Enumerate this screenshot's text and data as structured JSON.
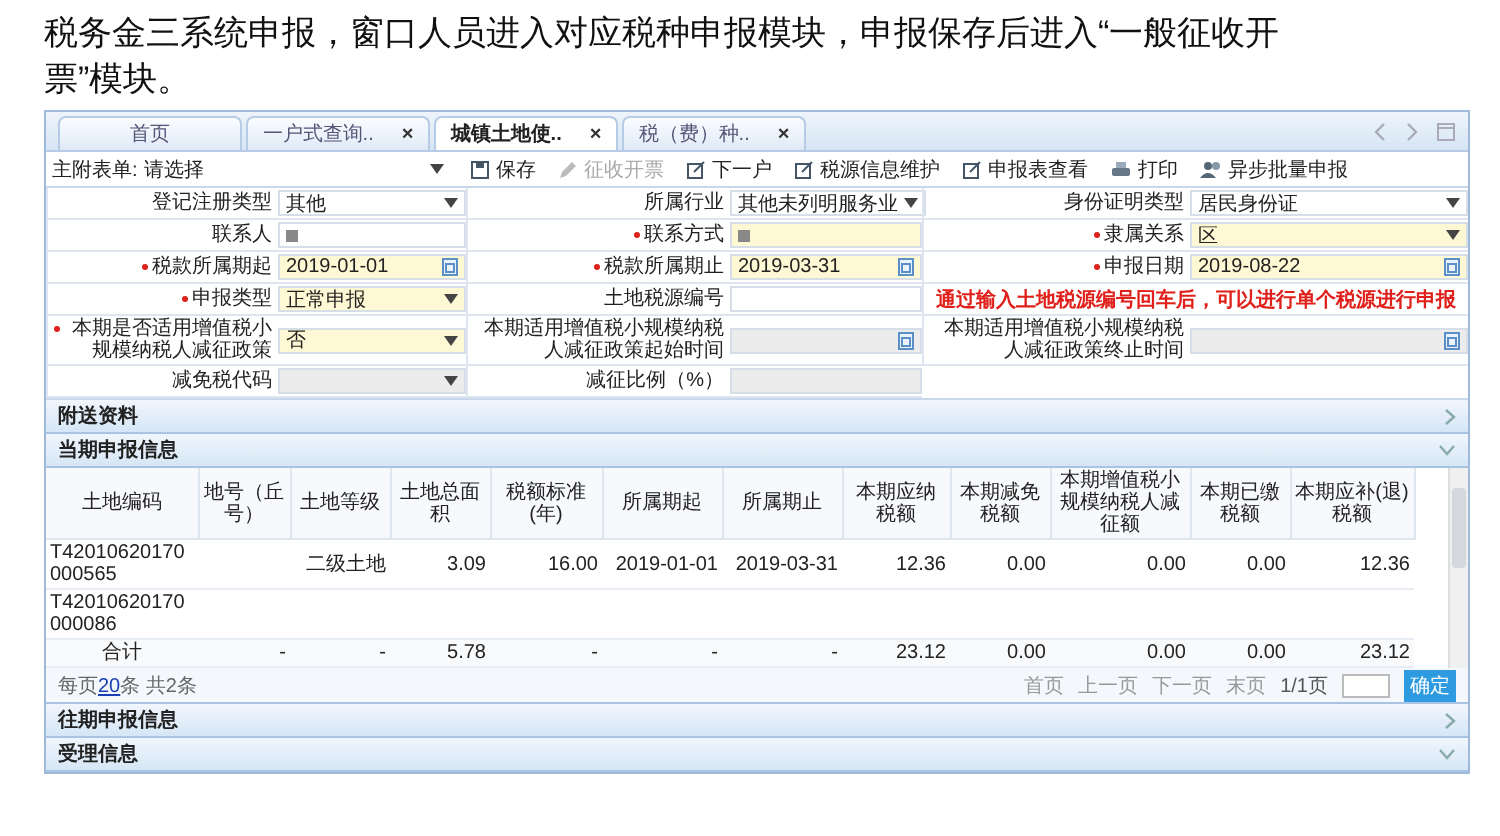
{
  "heading": "税务金三系统申报，窗口人员进入对应税种申报模块，申报保存后进入“一般征收开票”模块。",
  "tabs": [
    {
      "label": "首页",
      "selected": false
    },
    {
      "label": "一户式查询..",
      "close": "×",
      "selected": false
    },
    {
      "label": "城镇土地使..",
      "close": "×",
      "selected": true
    },
    {
      "label": "税（费）种..",
      "close": "×",
      "selected": false
    }
  ],
  "toolbar": {
    "form_select": {
      "label": "主附表单:",
      "value": "请选择"
    },
    "buttons": [
      {
        "label": "保存",
        "kind": "save",
        "disabled": false
      },
      {
        "label": "征收开票",
        "kind": "pencil",
        "disabled": true
      },
      {
        "label": "下一户",
        "kind": "edit",
        "disabled": false
      },
      {
        "label": "税源信息维护",
        "kind": "edit",
        "disabled": false
      },
      {
        "label": "申报表查看",
        "kind": "edit",
        "disabled": false
      },
      {
        "label": "打印",
        "kind": "print",
        "disabled": false
      },
      {
        "label": "异步批量申报",
        "kind": "people",
        "disabled": false
      }
    ]
  },
  "form": {
    "rows": [
      [
        {
          "label": "登记注册类型",
          "required": false,
          "disabled": false,
          "kind": "select",
          "value": "其他"
        },
        {
          "label": "所属行业",
          "required": false,
          "disabled": false,
          "kind": "select",
          "value": "其他未列明服务业"
        },
        {
          "label": "身份证明类型",
          "required": false,
          "disabled": false,
          "kind": "select",
          "value": "居民身份证"
        }
      ],
      [
        {
          "label": "联系人",
          "required": false,
          "disabled": false,
          "kind": "redacted"
        },
        {
          "label": "联系方式",
          "required": true,
          "disabled": false,
          "kind": "redacted"
        },
        {
          "label": "隶属关系",
          "required": true,
          "disabled": false,
          "kind": "select",
          "value": "区"
        }
      ],
      [
        {
          "label": "税款所属期起",
          "required": true,
          "disabled": false,
          "kind": "date",
          "value": "2019-01-01"
        },
        {
          "label": "税款所属期止",
          "required": true,
          "disabled": false,
          "kind": "date",
          "value": "2019-03-31"
        },
        {
          "label": "申报日期",
          "required": true,
          "disabled": false,
          "kind": "date",
          "value": "2019-08-22"
        }
      ],
      [
        {
          "label": "申报类型",
          "required": true,
          "disabled": false,
          "kind": "select",
          "value": "正常申报"
        },
        {
          "label": "土地税源编号",
          "required": false,
          "disabled": false,
          "kind": "text"
        },
        {
          "kind": "notice",
          "text": "通过输入土地税源编号回车后，可以进行单个税源进行申报"
        }
      ],
      [
        {
          "label": "本期是否适用增值税小规模纳税人减征政策",
          "required": true,
          "disabled": false,
          "kind": "select",
          "value": "否"
        },
        {
          "label": "本期适用增值税小规模纳税人减征政策起始时间",
          "required": false,
          "disabled": true,
          "kind": "date"
        },
        {
          "label": "本期适用增值税小规模纳税人减征政策终止时间",
          "required": false,
          "disabled": true,
          "kind": "date"
        }
      ],
      [
        {
          "label": "减免税代码",
          "required": false,
          "disabled": true,
          "kind": "select"
        },
        {
          "label": "减征比例（%）",
          "required": false,
          "disabled": true,
          "kind": "text"
        }
      ]
    ]
  },
  "sections": [
    {
      "title": "附送资料",
      "expanded": false
    },
    {
      "title": "当期申报信息",
      "expanded": true,
      "table": {
        "columns": [
          "土地编码",
          "地号（丘号）",
          "土地等级",
          "土地总面积",
          "税额标准(年)",
          "所属期起",
          "所属期止",
          "本期应纳税额",
          "本期减免税额",
          "本期增值税小规模纳税人减征额",
          "本期已缴税额",
          "本期应补(退)税额"
        ],
        "rows": [
          [
            "T42010620170000565",
            null,
            "二级土地",
            "3.09",
            "16.00",
            "2019-01-01",
            "2019-03-31",
            "12.36",
            "0.00",
            "0.00",
            "0.00",
            "12.36"
          ],
          [
            "T42010620170000086",
            null,
            null,
            null,
            null,
            null,
            null,
            null,
            null,
            null,
            null,
            null
          ]
        ],
        "total": [
          "合计",
          "-",
          "-",
          "5.78",
          "-",
          "-",
          "-",
          "23.12",
          "0.00",
          "0.00",
          "0.00",
          "23.12"
        ]
      },
      "pager": {
        "page_size_before": "每页",
        "page_size": "20",
        "page_size_after": "条 共2条",
        "links": [
          "首页",
          "上一页",
          "下一页",
          "末页"
        ],
        "page_info": "1/1页",
        "go_button": "确定"
      }
    },
    {
      "title": "往期申报信息",
      "expanded": false
    },
    {
      "title": "受理信息",
      "expanded": true
    }
  ]
}
